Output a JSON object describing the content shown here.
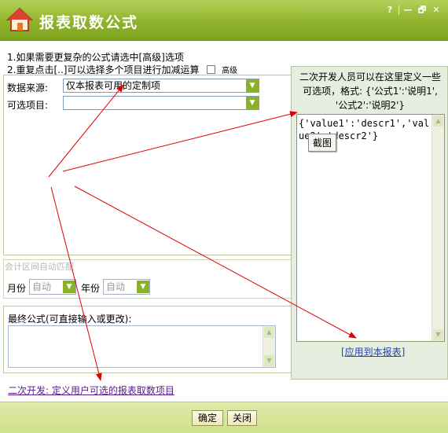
{
  "window": {
    "title": "报表取数公式",
    "controls": [
      "?",
      "—",
      "🗗",
      "✕"
    ]
  },
  "notes": {
    "line1": "1.如果需要更复杂的公式请选中[高级]选项",
    "line2": "2.重复点击[..]可以选择多个项目进行加减运算",
    "advanced_label": "高级",
    "advanced_checked": false
  },
  "source": {
    "label": "数据来源:",
    "value": "仅本报表可用的定制项",
    "item_label": "可选项目:",
    "item_value": ""
  },
  "period": {
    "legend": "会计区间自动匹配",
    "month_label": "月份",
    "month_value": "自动",
    "year_label": "年份",
    "year_value": "自动"
  },
  "formula": {
    "label": "最终公式(可直接输入或更改):",
    "value": ""
  },
  "dev_link": "二次开发: 定义用户可选的报表取数项目",
  "side": {
    "line1": "二次开发人员可以在这里定义一些",
    "line2": "可选项，格式: {'公式1':'说明1',",
    "line3": "'公式2':'说明2'}",
    "code": "{'value1':'descr1','value2':'descr2'}",
    "tooltip": "截图",
    "apply_link": "[应用到本报表]"
  },
  "buttons": {
    "ok": "确定",
    "close": "关闭"
  },
  "colors": {
    "titlebar": "#8fb32a",
    "footer": "#d5e59a",
    "arrow": "#e00000"
  }
}
